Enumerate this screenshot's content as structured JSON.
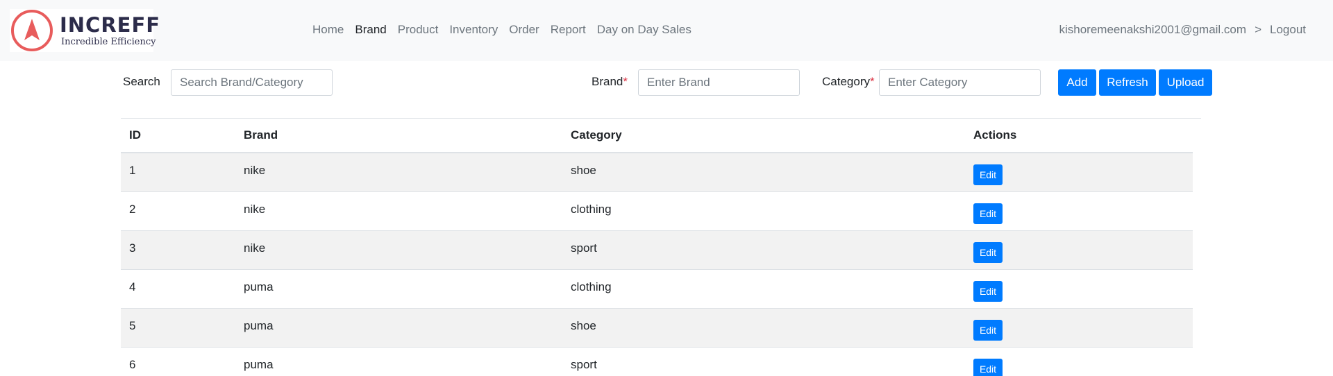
{
  "brand": {
    "name": "INCREFF",
    "tagline": "Incredible Efficiency"
  },
  "nav": {
    "items": [
      {
        "label": "Home",
        "active": false
      },
      {
        "label": "Brand",
        "active": true
      },
      {
        "label": "Product",
        "active": false
      },
      {
        "label": "Inventory",
        "active": false
      },
      {
        "label": "Order",
        "active": false
      },
      {
        "label": "Report",
        "active": false
      },
      {
        "label": "Day on Day Sales",
        "active": false
      }
    ],
    "user_email": "kishoremeenakshi2001@gmail.com",
    "separator": ">",
    "logout": "Logout"
  },
  "toolbar": {
    "search_label": "Search",
    "search_placeholder": "Search Brand/Category",
    "brand_label": "Brand",
    "brand_placeholder": "Enter Brand",
    "category_label": "Category",
    "category_placeholder": "Enter Category",
    "required_mark": "*",
    "add_label": "Add",
    "refresh_label": "Refresh",
    "upload_label": "Upload"
  },
  "table": {
    "headers": [
      "ID",
      "Brand",
      "Category",
      "Actions"
    ],
    "edit_label": "Edit",
    "rows": [
      {
        "id": "1",
        "brand": "nike",
        "category": "shoe"
      },
      {
        "id": "2",
        "brand": "nike",
        "category": "clothing"
      },
      {
        "id": "3",
        "brand": "nike",
        "category": "sport"
      },
      {
        "id": "4",
        "brand": "puma",
        "category": "clothing"
      },
      {
        "id": "5",
        "brand": "puma",
        "category": "shoe"
      },
      {
        "id": "6",
        "brand": "puma",
        "category": "sport"
      }
    ]
  },
  "colors": {
    "primary": "#007bff",
    "navbar_bg": "#f8f9fa",
    "logo_accent": "#e85c5c",
    "required": "#dc3545"
  }
}
